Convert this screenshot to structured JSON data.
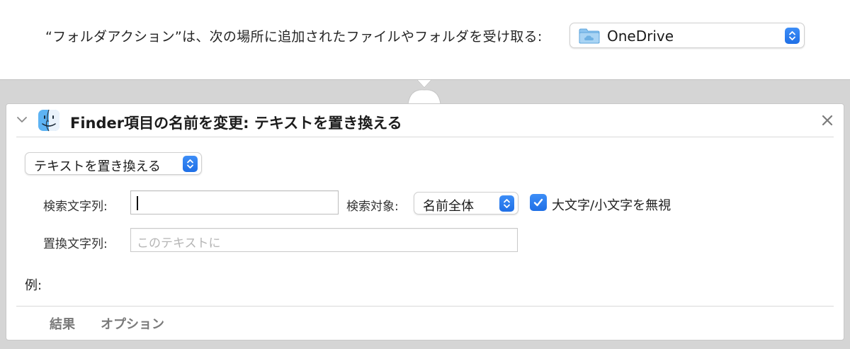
{
  "top_bar": {
    "prompt": "“フォルダアクション”は、次の場所に追加されたファイルやフォルダを受け取る:",
    "folder_select": {
      "value": "OneDrive",
      "icon": "folder-cloud-icon"
    }
  },
  "action": {
    "title": "Finder項目の名前を変更: テキストを置き換える",
    "mode_select": "テキストを置き換える",
    "search_label": "検索文字列:",
    "search_value": "",
    "target_label": "検索対象:",
    "target_select": "名前全体",
    "ignore_case_label": "大文字/小文字を無視",
    "ignore_case_checked": true,
    "replace_label": "置換文字列:",
    "replace_placeholder": "このテキストに",
    "example_label": "例:",
    "footer_tabs": [
      "結果",
      "オプション"
    ]
  },
  "colors": {
    "accent": "#2a7ff0",
    "background": "#d5d5d5",
    "folder": "#7fbbe8"
  }
}
